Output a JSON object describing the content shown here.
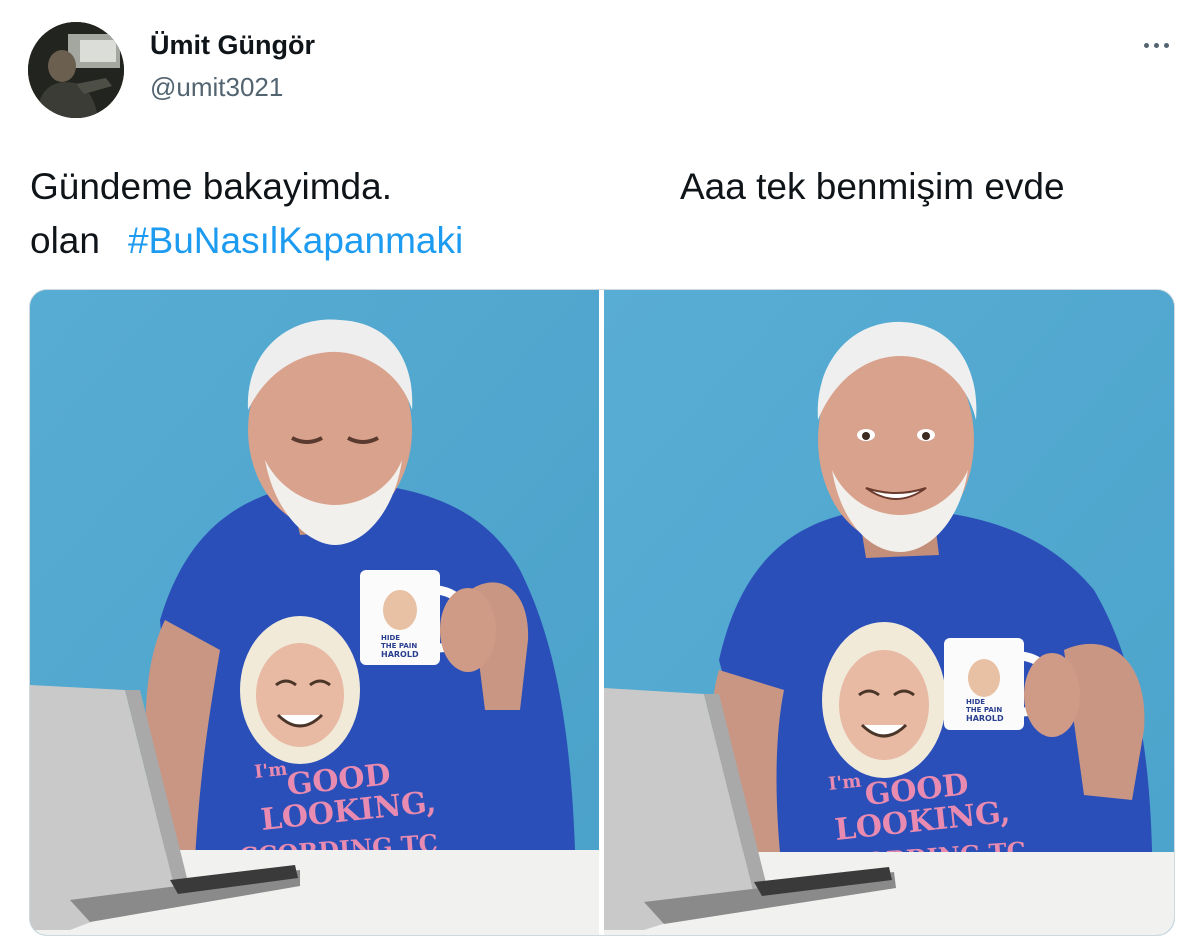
{
  "author": {
    "display_name": "Ümit Güngör",
    "handle": "@umit3021"
  },
  "tweet": {
    "line1_left": "Gündeme bakayimda.",
    "line1_right": "Aaa tek benmişim evde",
    "line2_prefix": "olan",
    "hashtag": "#BuNasılKapanmaki"
  },
  "media": {
    "shirt_line_1": "I'm",
    "shirt_line_2": "GOOD",
    "shirt_line_3": "LOOKING,",
    "shirt_line_4_left": "CCORDING TC",
    "shirt_line_4_right": "ORDING TC",
    "mug_line_1": "HIDE",
    "mug_line_2": "THE PAIN",
    "mug_line_3": "HAROLD"
  },
  "colors": {
    "link": "#1d9bf0",
    "text": "#0f1419",
    "secondary": "#536471",
    "photo_background": "#5aaed2",
    "shirt": "#2b4fb8"
  },
  "icons": {
    "more": "more-dots-icon"
  }
}
